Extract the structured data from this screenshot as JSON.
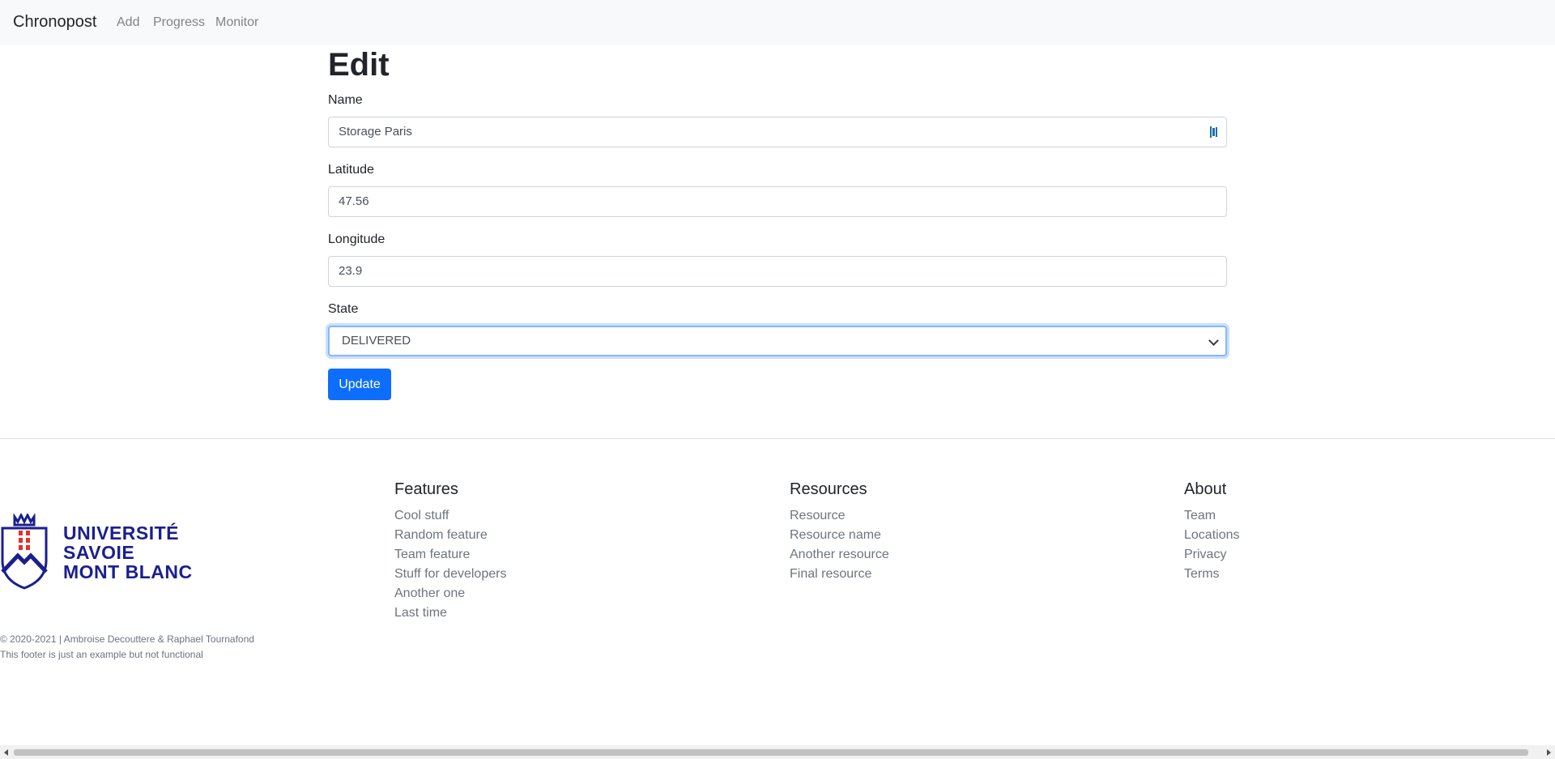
{
  "navbar": {
    "brand": "Chronopost",
    "links": [
      "Add",
      "Progress",
      "Monitor"
    ]
  },
  "form": {
    "title": "Edit",
    "name_label": "Name",
    "name_value": "Storage Paris",
    "latitude_label": "Latitude",
    "latitude_value": "47.56",
    "longitude_label": "Longitude",
    "longitude_value": "23.9",
    "state_label": "State",
    "state_value": "DELIVERED",
    "submit_label": "Update"
  },
  "footer": {
    "logo_lines": [
      "UNIVERSITÉ",
      "SAVOIE",
      "MONT BLANC"
    ],
    "copyright": "© 2020-2021 | Ambroise Decouttere & Raphael Tournafond",
    "note": "This footer is just an example but not functional",
    "columns": [
      {
        "heading": "Features",
        "items": [
          "Cool stuff",
          "Random feature",
          "Team feature",
          "Stuff for developers",
          "Another one",
          "Last time"
        ]
      },
      {
        "heading": "Resources",
        "items": [
          "Resource",
          "Resource name",
          "Another resource",
          "Final resource"
        ]
      },
      {
        "heading": "About",
        "items": [
          "Team",
          "Locations",
          "Privacy",
          "Terms"
        ]
      }
    ]
  },
  "colors": {
    "primary": "#0d6efd",
    "logo": "#1a1f8f",
    "logo_accent": "#e4312b",
    "muted": "#6c757d"
  },
  "icons": {
    "field_icon": "password-manager-icon",
    "select_icon": "chevron-down-icon"
  }
}
